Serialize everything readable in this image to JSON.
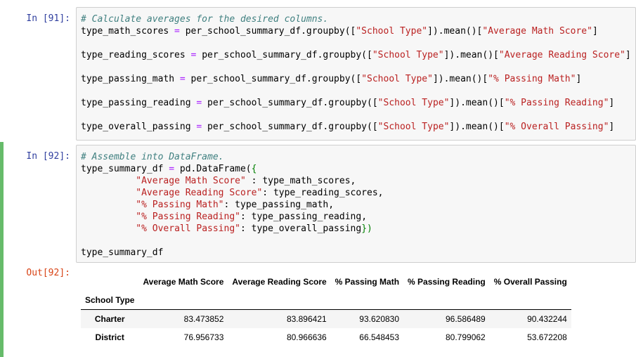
{
  "cells": [
    {
      "prompt": "In [91]:",
      "lines": [
        {
          "comment": "# Calculate averages for the desired columns."
        },
        {
          "var": "type_math_scores",
          "eq": " = ",
          "call": "per_school_summary_df.groupby([",
          "key": "\"School Type\"",
          "mid": "]).mean()[",
          "col": "\"Average Math Score\"",
          "end": "]"
        },
        {
          "var": "type_reading_scores",
          "eq": " = ",
          "call": "per_school_summary_df.groupby([",
          "key": "\"School Type\"",
          "mid": "]).mean()[",
          "col": "\"Average Reading Score\"",
          "end": "]"
        },
        {
          "var": "type_passing_math",
          "eq": " = ",
          "call": "per_school_summary_df.groupby([",
          "key": "\"School Type\"",
          "mid": "]).mean()[",
          "col": "\"% Passing Math\"",
          "end": "]"
        },
        {
          "var": "type_passing_reading",
          "eq": " = ",
          "call": "per_school_summary_df.groupby([",
          "key": "\"School Type\"",
          "mid": "]).mean()[",
          "col": "\"% Passing Reading\"",
          "end": "]"
        },
        {
          "var": "type_overall_passing",
          "eq": " = ",
          "call": "per_school_summary_df.groupby([",
          "key": "\"School Type\"",
          "mid": "]).mean()[",
          "col": "\"% Overall Passing\"",
          "end": "]"
        }
      ]
    },
    {
      "prompt": "In [92]:",
      "out_prompt": "Out[92]:",
      "lines": [
        {
          "comment": "# Assemble into DataFrame."
        },
        {
          "var": "type_summary_df",
          "eq": " = ",
          "call": "pd.DataFrame(",
          "brace": "{"
        },
        {
          "indent": "          ",
          "key": "\"Average Math Score\"",
          "sep": " : ",
          "val": "type_math_scores,"
        },
        {
          "indent": "          ",
          "key": "\"Average Reading Score\"",
          "sep": ": ",
          "val": "type_reading_scores,"
        },
        {
          "indent": "          ",
          "key": "\"% Passing Math\"",
          "sep": ": ",
          "val": "type_passing_math,"
        },
        {
          "indent": "          ",
          "key": "\"% Passing Reading\"",
          "sep": ": ",
          "val": "type_passing_reading,"
        },
        {
          "indent": "          ",
          "key": "\"% Overall Passing\"",
          "sep": ": ",
          "val": "type_overall_passing",
          "close": "})"
        },
        {
          "plain": "type_summary_df"
        }
      ]
    }
  ],
  "output_table": {
    "columns": [
      "Average Math Score",
      "Average Reading Score",
      "% Passing Math",
      "% Passing Reading",
      "% Overall Passing"
    ],
    "index_name": "School Type",
    "rows": [
      {
        "index": "Charter",
        "values": [
          "83.473852",
          "83.896421",
          "93.620830",
          "96.586489",
          "90.432244"
        ]
      },
      {
        "index": "District",
        "values": [
          "76.956733",
          "80.966636",
          "66.548453",
          "80.799062",
          "53.672208"
        ]
      }
    ]
  }
}
